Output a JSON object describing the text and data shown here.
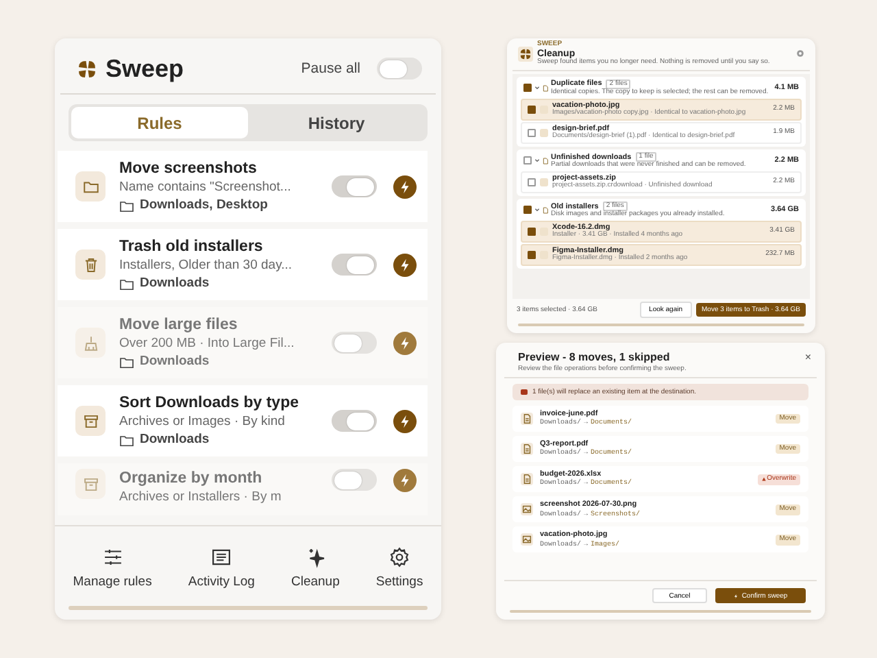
{
  "app": {
    "title": "Sweep",
    "pause_label": "Pause all",
    "pause_on": false
  },
  "tabs": [
    {
      "label": "Rules",
      "selected": true
    },
    {
      "label": "History",
      "selected": false
    }
  ],
  "rules": [
    {
      "title": "Move screenshots",
      "detail": "Name contains \"Screenshot...",
      "location": "Downloads, Desktop",
      "enabled": true
    },
    {
      "title": "Trash old installers",
      "detail": "Installers, Older than 30 day...",
      "location": "Downloads",
      "enabled": true
    },
    {
      "title": "Move large files",
      "detail": "Over 200 MB · Into Large Fil...",
      "location": "Downloads",
      "enabled": false
    },
    {
      "title": "Sort Downloads by type",
      "detail": "Archives or Images · By kind",
      "location": "Downloads",
      "enabled": true
    },
    {
      "title": "Organize by month",
      "detail": "Archives or Installers · By m",
      "enabled": false
    }
  ],
  "nav": [
    {
      "label": "Manage rules"
    },
    {
      "label": "Activity Log"
    },
    {
      "label": "Cleanup"
    },
    {
      "label": "Settings"
    }
  ],
  "cleanup": {
    "eyebrow": "SWEEP",
    "title": "Cleanup",
    "subtitle": "Sweep found items you no longer need. Nothing is removed until you say so.",
    "groups": [
      {
        "name": "Duplicate files",
        "tag": "2 files",
        "description": "Identical copies. The copy to keep is selected; the rest can be removed.",
        "size": "4.1 MB",
        "checked": true,
        "items": [
          {
            "name": "vacation-photo.jpg",
            "detail": "Images/vacation-photo copy.jpg · Identical to vacation-photo.jpg",
            "size": "2.2 MB",
            "checked": true
          },
          {
            "name": "design-brief.pdf",
            "detail": "Documents/design-brief (1).pdf · Identical to design-brief.pdf",
            "size": "1.9 MB",
            "checked": false
          }
        ]
      },
      {
        "name": "Unfinished downloads",
        "tag": "1 file",
        "description": "Partial downloads that were never finished and can be removed.",
        "size": "2.2 MB",
        "checked": false,
        "items": [
          {
            "name": "project-assets.zip",
            "detail": "project-assets.zip.crdownload · Unfinished download",
            "size": "2.2 MB",
            "checked": false
          }
        ]
      },
      {
        "name": "Old installers",
        "tag": "2 files",
        "description": "Disk images and installer packages you already installed.",
        "size": "3.64 GB",
        "checked": true,
        "items": [
          {
            "name": "Xcode-16.2.dmg",
            "detail": "Installer · 3.41 GB · Installed 4 months ago",
            "size": "3.41 GB",
            "checked": true
          },
          {
            "name": "Figma-Installer.dmg",
            "detail": "Figma-Installer.dmg · Installed 2 months ago",
            "size": "232.7 MB",
            "checked": true
          }
        ]
      }
    ],
    "footer_note": "3 items selected · 3.64 GB",
    "secondary": "Look again",
    "primary": "Move 3 items to Trash · 3.64 GB"
  },
  "preview": {
    "title": "Preview - 8 moves, 1 skipped",
    "subtitle": "Review the file operations before confirming the sweep.",
    "close": "×",
    "warning": "1 file(s) will replace an existing item at the destination.",
    "arrow": "→",
    "items": [
      {
        "name": "invoice-june.pdf",
        "from": "Downloads/",
        "to": "Documents/",
        "badge": "Move",
        "kind": "move"
      },
      {
        "name": "Q3-report.pdf",
        "from": "Downloads/",
        "to": "Documents/",
        "badge": "Move",
        "kind": "move"
      },
      {
        "name": "budget-2026.xlsx",
        "from": "Downloads/",
        "to": "Documents/",
        "badge": "Overwrite",
        "kind": "overwrite"
      },
      {
        "name": "screenshot 2026-07-30.png",
        "from": "Downloads/",
        "to": "Screenshots/",
        "badge": "Move",
        "kind": "move"
      },
      {
        "name": "vacation-photo.jpg",
        "from": "Downloads/",
        "to": "Images/",
        "badge": "Move",
        "kind": "move"
      }
    ],
    "cancel": "Cancel",
    "confirm": "Confirm sweep"
  }
}
